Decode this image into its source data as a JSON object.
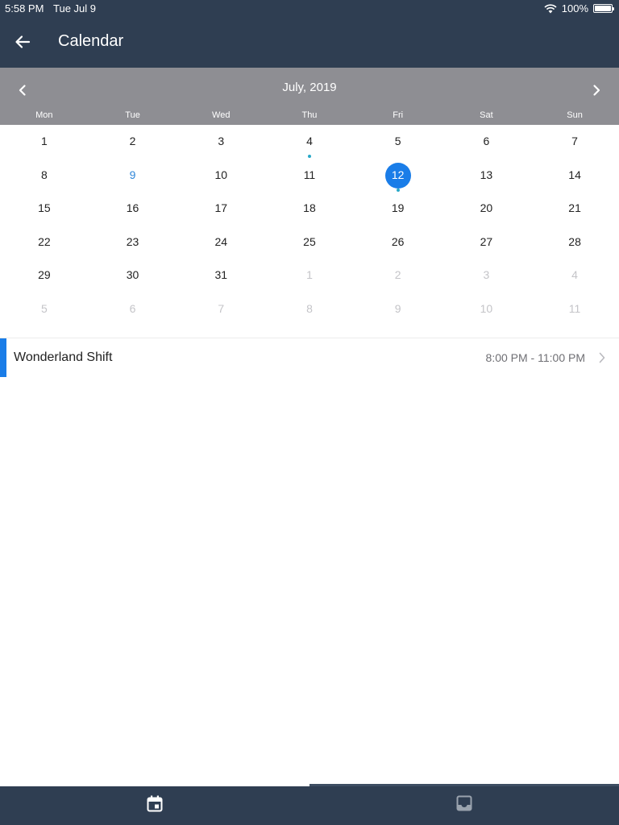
{
  "status_bar": {
    "time": "5:58 PM",
    "date": "Tue Jul 9",
    "battery": "100%"
  },
  "nav": {
    "title": "Calendar",
    "back_icon": "arrow-left-icon"
  },
  "calendar": {
    "month_label": "July, 2019",
    "prev_icon": "chevron-left-icon",
    "next_icon": "chevron-right-icon",
    "weekdays": [
      "Mon",
      "Tue",
      "Wed",
      "Thu",
      "Fri",
      "Sat",
      "Sun"
    ],
    "weeks": [
      [
        {
          "d": "1"
        },
        {
          "d": "2"
        },
        {
          "d": "3"
        },
        {
          "d": "4",
          "dot": true
        },
        {
          "d": "5"
        },
        {
          "d": "6"
        },
        {
          "d": "7"
        }
      ],
      [
        {
          "d": "8"
        },
        {
          "d": "9",
          "today": true
        },
        {
          "d": "10"
        },
        {
          "d": "11"
        },
        {
          "d": "12",
          "selected": true,
          "dot": true
        },
        {
          "d": "13"
        },
        {
          "d": "14"
        }
      ],
      [
        {
          "d": "15"
        },
        {
          "d": "16"
        },
        {
          "d": "17"
        },
        {
          "d": "18"
        },
        {
          "d": "19"
        },
        {
          "d": "20"
        },
        {
          "d": "21"
        }
      ],
      [
        {
          "d": "22"
        },
        {
          "d": "23"
        },
        {
          "d": "24"
        },
        {
          "d": "25"
        },
        {
          "d": "26"
        },
        {
          "d": "27"
        },
        {
          "d": "28"
        }
      ],
      [
        {
          "d": "29"
        },
        {
          "d": "30"
        },
        {
          "d": "31"
        },
        {
          "d": "1",
          "other": true
        },
        {
          "d": "2",
          "other": true
        },
        {
          "d": "3",
          "other": true
        },
        {
          "d": "4",
          "other": true
        }
      ],
      [
        {
          "d": "5",
          "other": true
        },
        {
          "d": "6",
          "other": true
        },
        {
          "d": "7",
          "other": true
        },
        {
          "d": "8",
          "other": true
        },
        {
          "d": "9",
          "other": true
        },
        {
          "d": "10",
          "other": true
        },
        {
          "d": "11",
          "other": true
        }
      ]
    ]
  },
  "events": [
    {
      "title": "Wonderland Shift",
      "time": "8:00 PM - 11:00 PM",
      "accent_color": "#1a7de8"
    }
  ],
  "tab_bar": {
    "tabs": [
      {
        "icon": "calendar-icon",
        "active": true
      },
      {
        "icon": "inbox-icon",
        "active": false
      }
    ]
  },
  "colors": {
    "header_bg": "#2f3e52",
    "month_header_bg": "#8e8e93",
    "accent": "#1a7de8",
    "event_dot": "#28a8c8"
  }
}
